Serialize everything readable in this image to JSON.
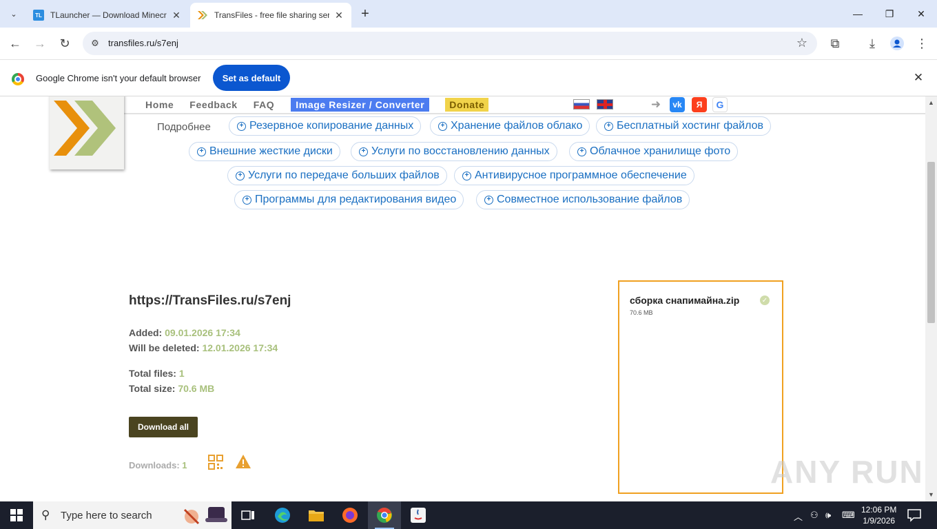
{
  "browser": {
    "tabs": [
      {
        "title": "TLauncher — Download Minecraft",
        "favicon": "tlauncher-icon"
      },
      {
        "title": "TransFiles - free file sharing service",
        "favicon": "transfiles-icon"
      }
    ],
    "address": "transfiles.ru/s7enj",
    "infobar": {
      "message": "Google Chrome isn't your default browser",
      "button": "Set as default"
    }
  },
  "site": {
    "nav": {
      "home": "Home",
      "feedback": "Feedback",
      "faq": "FAQ",
      "resizer": "Image Resizer / Converter",
      "donate": "Donate"
    },
    "more_label": "Подробнее",
    "pills": [
      "Резервное копирование данных",
      "Хранение файлов облако",
      "Бесплатный хостинг файлов",
      "Внешние жесткие диски",
      "Услуги по восстановлению данных",
      "Облачное хранилище фото",
      "Услуги по передаче больших файлов",
      "Антивирусное программное обеспечение",
      "Программы для редактирования видео",
      "Совместное использование файлов"
    ],
    "share_url": "https://TransFiles.ru/s7enj",
    "added_label": "Added:",
    "added_value": "09.01.2026 17:34",
    "deleted_label": "Will be deleted:",
    "deleted_value": "12.01.2026 17:34",
    "total_files_label": "Total files:",
    "total_files_value": "1",
    "total_size_label": "Total size:",
    "total_size_value": "70.6 MB",
    "download_all": "Download all",
    "downloads_label": "Downloads:",
    "downloads_value": "1",
    "file": {
      "name": "сборка снапимайна.zip",
      "size": "70.6 MB"
    },
    "accent_colors": {
      "orange": "#f0a020",
      "green": "#a8c07c",
      "link": "#1a6fc2"
    }
  },
  "watermark": "ANY RUN",
  "taskbar": {
    "search_placeholder": "Type here to search",
    "time": "12:06 PM",
    "date": "1/9/2026"
  }
}
